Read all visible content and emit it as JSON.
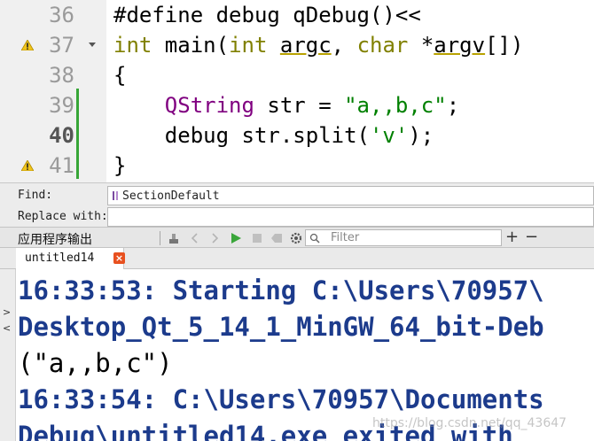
{
  "editor": {
    "lines": [
      {
        "number": "36",
        "current": false,
        "warning": false,
        "fold": false
      },
      {
        "number": "37",
        "current": false,
        "warning": true,
        "fold": true
      },
      {
        "number": "38",
        "current": false,
        "warning": false,
        "fold": false
      },
      {
        "number": "39",
        "current": false,
        "warning": false,
        "fold": false
      },
      {
        "number": "40",
        "current": true,
        "warning": false,
        "fold": false
      },
      {
        "number": "41",
        "current": false,
        "warning": true,
        "fold": false
      }
    ],
    "code": {
      "l36": "#define debug qDebug()<<",
      "l37_kw1": "int",
      "l37_main": " main(",
      "l37_kw2": "int",
      "l37_sp": " ",
      "l37_argc": "argc",
      "l37_comma": ", ",
      "l37_kw3": "char",
      "l37_star": " *",
      "l37_argv": "argv",
      "l37_end": "[])",
      "l38": "{",
      "l39_indent": "    ",
      "l39_type": "QString",
      "l39_mid": " str = ",
      "l39_str": "\"a,,b,c\"",
      "l39_end": ";",
      "l40_a": "    debug str.split(",
      "l40_str": "'v'",
      "l40_end": ");",
      "l41": "}"
    }
  },
  "find": {
    "find_label": "Find:",
    "find_value": "SectionDefault",
    "replace_label": "Replace with:"
  },
  "output_pane": {
    "title": "应用程序输出",
    "filter_placeholder": "Filter",
    "plus": "+",
    "minus": "−",
    "tab_label": "untitled14",
    "tab_close": "×"
  },
  "output": {
    "line1": "16:33:53: Starting C:\\Users\\70957\\",
    "line2": "Desktop_Qt_5_14_1_MinGW_64_bit-Deb",
    "line3": "(\"a,,b,c\")",
    "line4": "16:33:54: C:\\Users\\70957\\Documents",
    "line5": "Debug\\untitled14.exe exited with",
    "watermark": "https://blog.csdn.net/qq_43647"
  },
  "colors": {
    "keyword": "#808000",
    "type": "#800080",
    "string": "#008000",
    "system_output": "#1c3b8c",
    "change_bar": "#37a637",
    "tab_close": "#e8501f"
  }
}
